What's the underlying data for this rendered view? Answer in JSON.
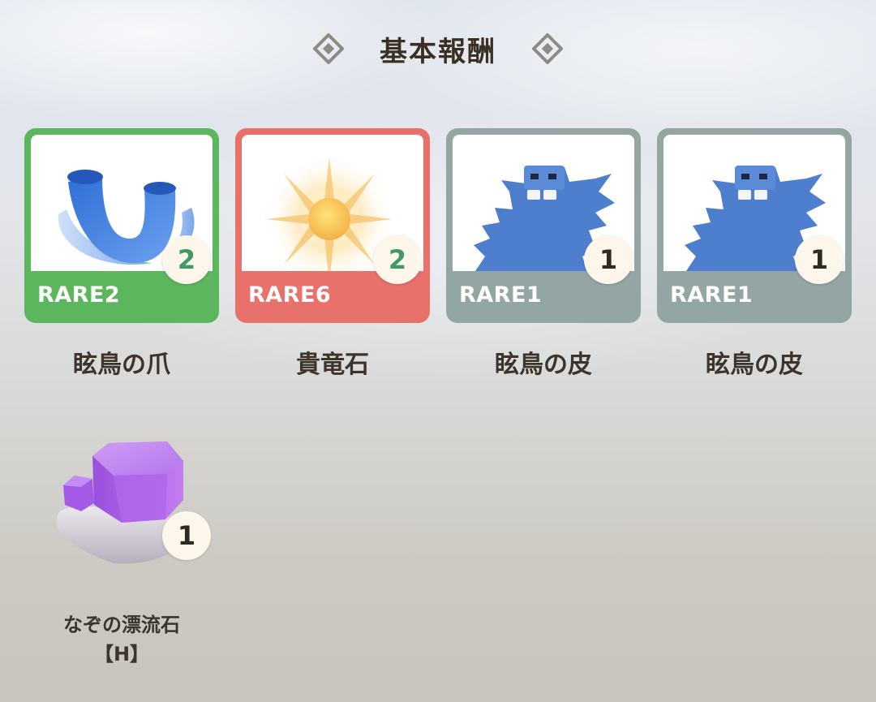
{
  "header": {
    "title": "基本報酬",
    "icon": "diamond-icon"
  },
  "items": [
    {
      "rarity": "RARE2",
      "count": "2",
      "name": "眩鳥の爪",
      "frame_color": "#5cb65e",
      "count_color": "#3f9a63",
      "icon": "claw-icon"
    },
    {
      "rarity": "RARE6",
      "count": "2",
      "name": "貴竜石",
      "frame_color": "#e8716c",
      "count_color": "#3f9a63",
      "icon": "sun-stone-icon"
    },
    {
      "rarity": "RARE1",
      "count": "1",
      "name": "眩鳥の皮",
      "frame_color": "#94a6a4",
      "count_color": "#2e2a24",
      "icon": "hide-icon"
    },
    {
      "rarity": "RARE1",
      "count": "1",
      "name": "眩鳥の皮",
      "frame_color": "#94a6a4",
      "count_color": "#2e2a24",
      "icon": "hide-icon"
    },
    {
      "rarity": "",
      "count": "1",
      "name_line1": "なぞの漂流石",
      "name_line2": "【H】",
      "icon": "purple-stone-icon"
    }
  ]
}
